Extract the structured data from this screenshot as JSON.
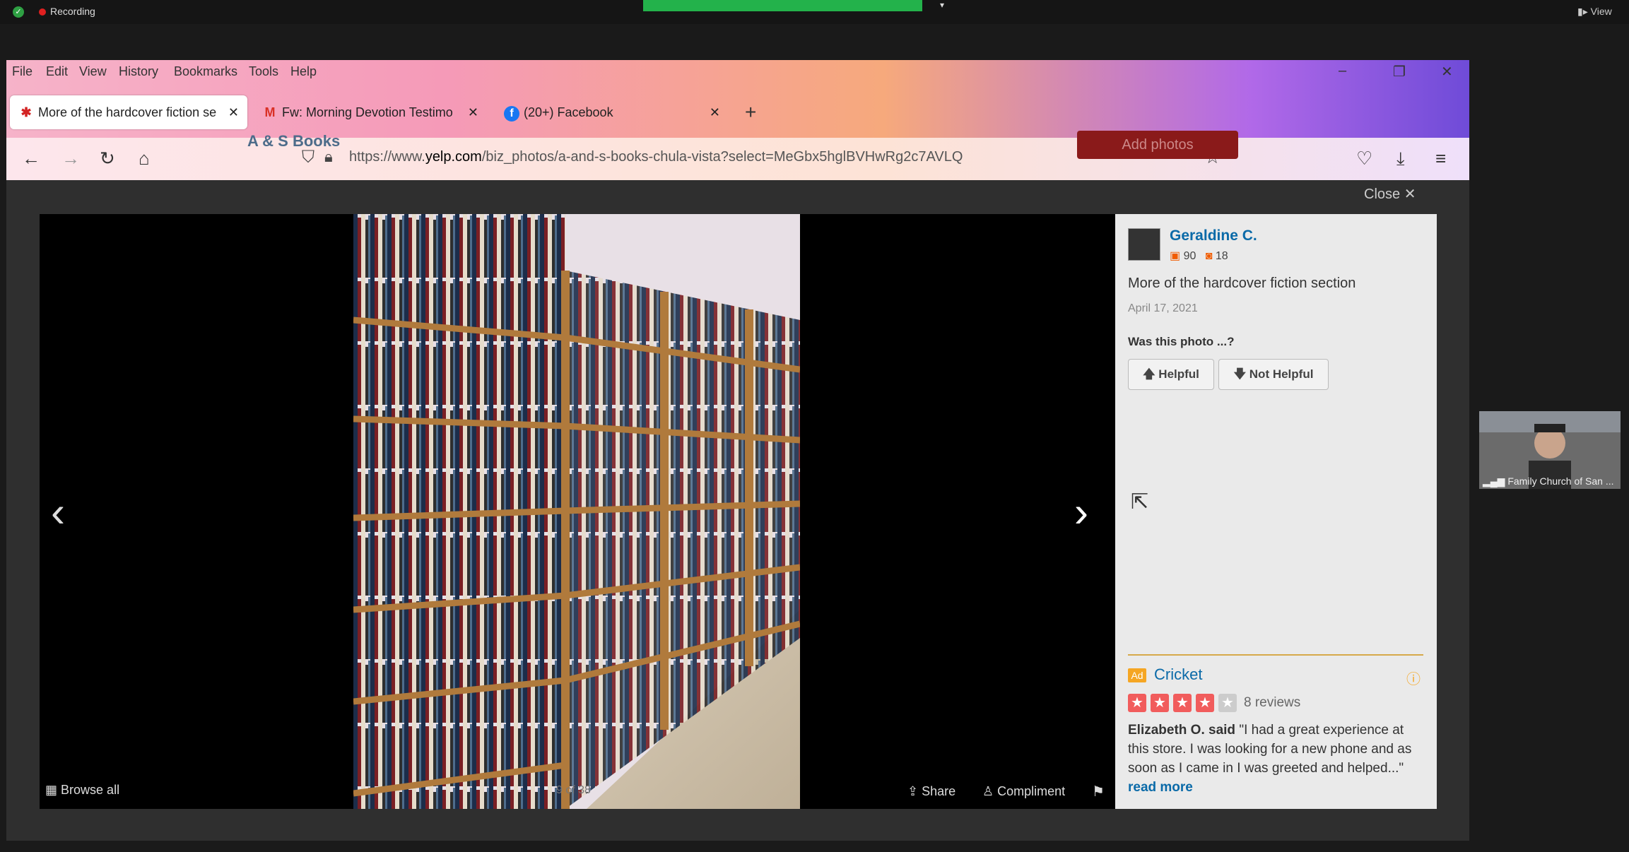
{
  "zoom": {
    "recording": "Recording",
    "view": "View",
    "participant_name": "Family Church of San ..."
  },
  "browser": {
    "menu": [
      "File",
      "Edit",
      "View",
      "History",
      "Bookmarks",
      "Tools",
      "Help"
    ],
    "tabs": [
      {
        "label": "More of the hardcover fiction se",
        "icon": "yelp-icon"
      },
      {
        "label": "Fw: Morning Devotion Testimo",
        "icon": "gmail-icon"
      },
      {
        "label": "(20+) Facebook",
        "icon": "facebook-icon"
      }
    ],
    "url_prefix": "https://www.",
    "url_domain": "yelp.com",
    "url_path": "/biz_photos/a-and-s-books-chula-vista?select=MeGbx5hglBVHwRg2c7AVLQ"
  },
  "page": {
    "business_name": "A & S Books",
    "add_photos": "Add photos",
    "close": "Close"
  },
  "viewer": {
    "browse_all": "Browse all",
    "counter": "9 of 38",
    "share": "Share",
    "compliment": "Compliment"
  },
  "photo_panel": {
    "user_name": "Geraldine C.",
    "friends": "90",
    "reviews_count": "18",
    "caption": "More of the hardcover fiction section",
    "date": "April 17, 2021",
    "question": "Was this photo ...?",
    "helpful": "Helpful",
    "not_helpful": "Not Helpful"
  },
  "ad": {
    "tag": "Ad",
    "name": "Cricket",
    "rating": 4,
    "reviews": "8 reviews",
    "reviewer": "Elizabeth O. said",
    "quote": " \"I had a great experience at this store. I was looking for a new phone and as soon as I came in I was greeted and helped...\"",
    "read_more": "read more"
  },
  "colors": {
    "accent_blue": "#0a6aa8",
    "yelp_red": "#f15c5c",
    "yelp_orange": "#f15c00"
  }
}
